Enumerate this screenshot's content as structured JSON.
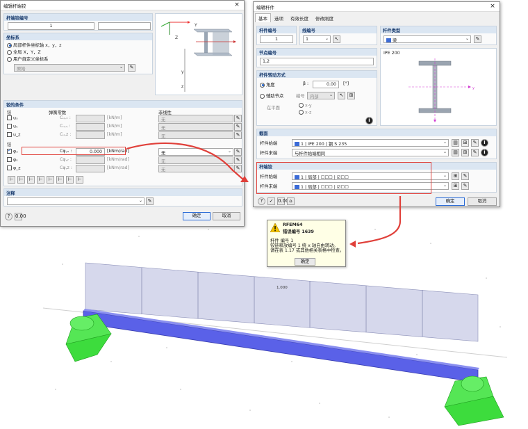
{
  "left_dialog": {
    "title": "编辑杆端铰",
    "close": "×",
    "release_no_label": "杆端铰编号",
    "release_no": "1",
    "coord_sys": {
      "header": "坐标系",
      "opt1": "局部杆件坐标轴 x，y，z",
      "opt2": "全局 X，Y，Z",
      "opt3": "用户自定义坐标系",
      "dd_value": "原始"
    },
    "release_header": "铰的条件",
    "col_release": "铰",
    "col_spring": "弹簧常数",
    "col_nonlin": "非线性",
    "disp_rows": [
      {
        "label": "uₓ",
        "c": "Cᵤ,ₓ :",
        "unit": "[kN/m]",
        "nl": "无"
      },
      {
        "label": "uᵧ",
        "c": "Cᵤ,ᵧ :",
        "unit": "[kN/m]",
        "nl": "无"
      },
      {
        "label": "u_z",
        "c": "Cᵤ,z :",
        "unit": "[kN/m]",
        "nl": "无"
      }
    ],
    "rot_header": "铰",
    "rot_rows": [
      {
        "label": "φₓ",
        "c": "Cφ,ₓ :",
        "value": "0.000",
        "unit": "[kNm/rad]",
        "nl": "无",
        "checked": true
      },
      {
        "label": "φᵧ",
        "c": "Cφ,ᵧ :",
        "value": "",
        "unit": "[kNm/rad]",
        "nl": "无",
        "checked": false
      },
      {
        "label": "φ_z",
        "c": "Cφ,z :",
        "value": "",
        "unit": "[kNm/rad]",
        "nl": "无",
        "checked": false
      }
    ],
    "comment_header": "注释",
    "ok": "确定",
    "cancel": "取消"
  },
  "right_dialog": {
    "title": "编辑杆件",
    "close": "×",
    "tabs": [
      "基本",
      "选项",
      "有效长度",
      "修改刚度"
    ],
    "member_no_label": "杆件编号",
    "member_no": "1",
    "line_no_label": "线编号",
    "line_no": "1",
    "member_type_label": "杆件类型",
    "member_type": "梁",
    "node_label": "节点编号",
    "node_value": "1,2",
    "section_preview": "IPE 200",
    "rotation_header": "杆件转动方式",
    "angle_label": "角度",
    "beta_label": "β :",
    "angle_value": "0.00",
    "angle_unit": "[°]",
    "helpnode_label": "辅助节点",
    "node_no_label": "编号",
    "inside_label": "内部",
    "in_plane_label": "在平面",
    "xy": "x-y",
    "xz": "x-z",
    "section_header": "截面",
    "member_start": "杆件始端",
    "member_end": "杆件末端",
    "section_start": "1 | IPE 200 | 钢 S 235",
    "section_end": "与杆件始端相同",
    "hinge_header": "杆端铰",
    "hinge_start_label": "杆件始端",
    "hinge_end_label": "杆件末端",
    "hinge_start": "1 | 局部 | ☐☐☐ | ☑☐☐",
    "hinge_end": "1 | 局部 | ☐☐☐ | ☑☐☐",
    "ok": "确定",
    "cancel": "取消"
  },
  "alert": {
    "title": "RFEM64",
    "subtitle": "错误编号 1639",
    "line1": "杆件 编号 1",
    "line2": "铰链释放编号 1 绕 x 轴自由转动。",
    "line3": "请在表 1.17 或其他相关表格中检查。",
    "ok": "确定"
  },
  "model": {
    "load_label": "1.000"
  },
  "colors": {
    "accent": "#1b5ec9",
    "highlight": "#e0403a",
    "beam": "#5a61e8",
    "support": "#3ddc3d"
  }
}
